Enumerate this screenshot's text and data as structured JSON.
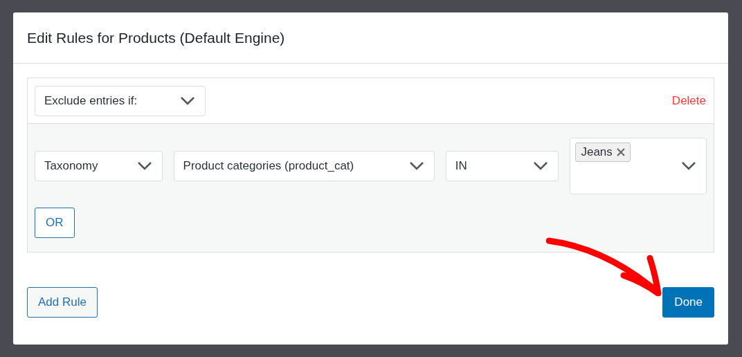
{
  "dialog": {
    "title": "Edit Rules for Products (Default Engine)"
  },
  "rule": {
    "condition": "Exclude entries if:",
    "delete_link": "Delete",
    "clause": {
      "field": "Taxonomy",
      "taxonomy": "Product categories (product_cat)",
      "operator": "IN",
      "values": [
        "Jeans"
      ]
    },
    "or_button": "OR"
  },
  "footer": {
    "add_rule_button": "Add Rule",
    "done_button": "Done"
  }
}
